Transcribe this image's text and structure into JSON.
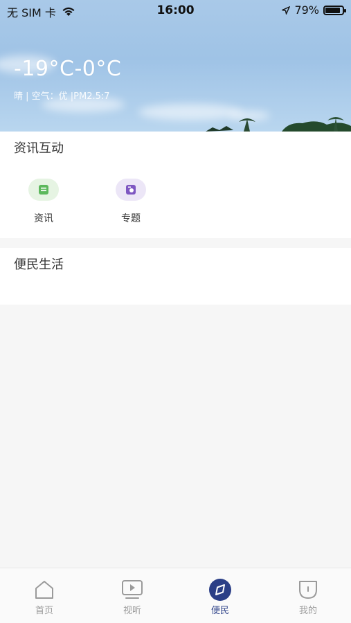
{
  "status_bar": {
    "carrier": "无 SIM 卡",
    "time": "16:00",
    "battery": "79%",
    "battery_level": 0.79
  },
  "weather": {
    "temperature": "-19°C-0°C",
    "details": "晴 | 空气：优 |PM2.5:7"
  },
  "section_news": {
    "title": "资讯互动",
    "items": [
      {
        "label": "资讯",
        "icon": "news-icon",
        "color": "#5cb85c"
      },
      {
        "label": "专题",
        "icon": "topic-icon",
        "color": "#7e57c2"
      }
    ]
  },
  "section_life": {
    "title": "便民生活"
  },
  "tabbar": {
    "active_color": "#2b3f87",
    "items": [
      {
        "label": "首页",
        "icon": "home-icon"
      },
      {
        "label": "视听",
        "icon": "video-icon"
      },
      {
        "label": "便民",
        "icon": "compass-icon"
      },
      {
        "label": "我的",
        "icon": "profile-icon"
      }
    ]
  }
}
